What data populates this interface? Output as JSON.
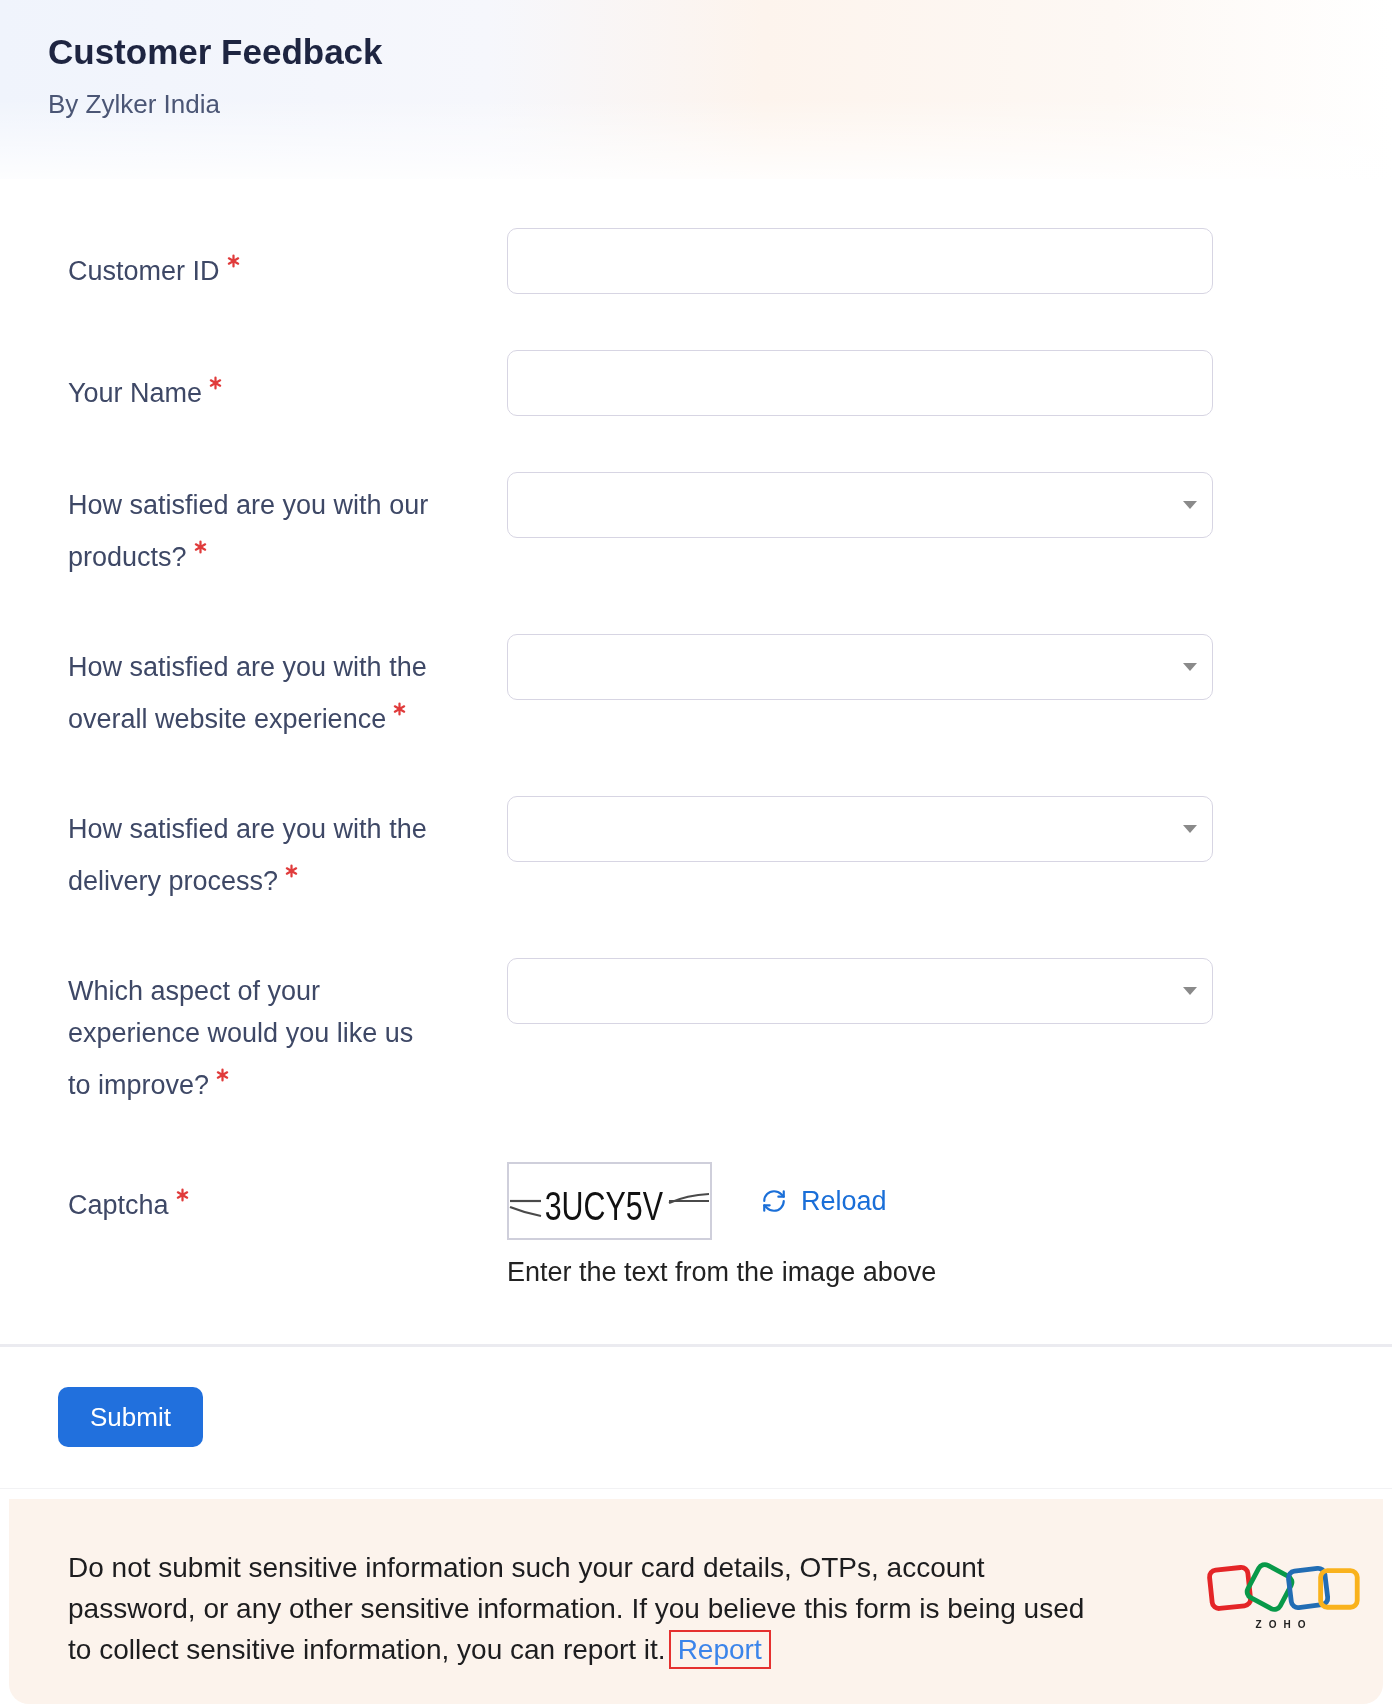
{
  "header": {
    "title": "Customer Feedback",
    "subtitle": "By Zylker India"
  },
  "fields": [
    {
      "kind": "text",
      "label": "Customer ID",
      "required": true
    },
    {
      "kind": "text",
      "label": "Your Name",
      "required": true
    },
    {
      "kind": "dropdown",
      "label": "How satisfied are you with our products?",
      "required": true
    },
    {
      "kind": "dropdown",
      "label": "How satisfied are you with the overall website experience",
      "required": true
    },
    {
      "kind": "dropdown",
      "label": "How satisfied are you with the delivery process?",
      "required": true
    },
    {
      "kind": "dropdown",
      "label": "Which aspect of your experience would you like us to improve?",
      "required": true
    }
  ],
  "captcha": {
    "label": "Captcha",
    "required": true,
    "image_text": "3UCY5V",
    "reload": "Reload",
    "hint": "Enter the text from the image above"
  },
  "submit_button": {
    "label": "Submit"
  },
  "notice": {
    "text": "Do not submit sensitive information such your card details, OTPs, account password, or any other sensitive information. If you believe this form is being used to collect sensitive information, you can report it.",
    "link": {
      "label": "Report",
      "highlighted": true
    },
    "logo_text": "ZOHO"
  }
}
